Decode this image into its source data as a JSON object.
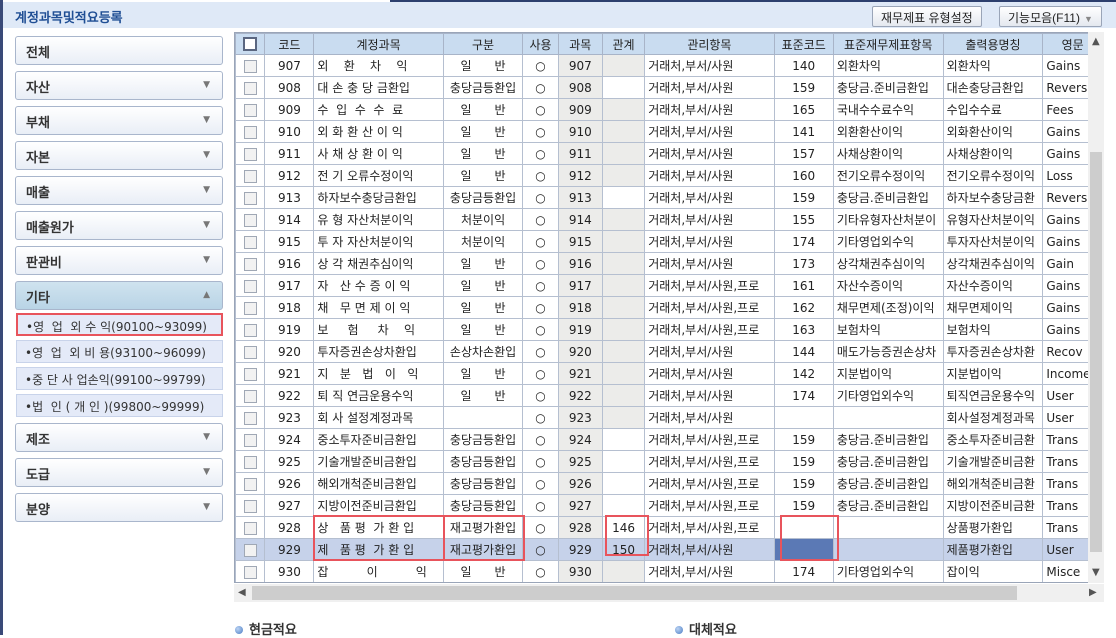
{
  "window": {
    "title": "계정과목및적요등록"
  },
  "toolbar": {
    "fs_type_label": "재무제표 유형설정",
    "functions_label": "기능모음(F11)"
  },
  "sidebar": {
    "groups": [
      {
        "label": "전체"
      },
      {
        "label": "자산"
      },
      {
        "label": "부채"
      },
      {
        "label": "자본"
      },
      {
        "label": "매출"
      },
      {
        "label": "매출원가"
      },
      {
        "label": "판관비"
      },
      {
        "label": "기타",
        "open": true
      },
      {
        "label": "제조"
      },
      {
        "label": "도급"
      },
      {
        "label": "분양"
      }
    ],
    "subitems": [
      {
        "label": "•영  업  외 수 익(90100~93099)",
        "selected": true
      },
      {
        "label": "•영  업  외 비 용(93100~96099)"
      },
      {
        "label": "•중 단 사 업손익(99100~99799)"
      },
      {
        "label": "•법  인 ( 개 인 )(99800~99999)"
      }
    ]
  },
  "table": {
    "columns": [
      "",
      "코드",
      "계정과목",
      "구분",
      "사용",
      "과목",
      "관계",
      "관리항목",
      "표준코드",
      "표준재무제표항목",
      "출력용명칭",
      "영문"
    ],
    "rows": [
      {
        "code": "907",
        "name": "외    환    차    익",
        "type": "일      반",
        "use": "○",
        "subj": "907",
        "rel": "",
        "mgmt": "거래처,부서/사원",
        "std": "140",
        "stdname": "외환차익",
        "out": "외환차익",
        "eng": "Gains",
        "relw": false
      },
      {
        "code": "908",
        "name": "대 손 충 당 금환입",
        "type": "충당금등환입",
        "use": "○",
        "subj": "908",
        "rel": "",
        "mgmt": "거래처,부서/사원",
        "std": "159",
        "stdname": "충당금.준비금환입",
        "out": "대손충당금환입",
        "eng": "Revers",
        "relw": true
      },
      {
        "code": "909",
        "name": "수  입  수  수  료",
        "type": "일      반",
        "use": "○",
        "subj": "909",
        "rel": "",
        "mgmt": "거래처,부서/사원",
        "std": "165",
        "stdname": "국내수수료수익",
        "out": "수입수수료",
        "eng": "Fees",
        "relw": false
      },
      {
        "code": "910",
        "name": "외 화 환 산 이 익",
        "type": "일      반",
        "use": "○",
        "subj": "910",
        "rel": "",
        "mgmt": "거래처,부서/사원",
        "std": "141",
        "stdname": "외환환산이익",
        "out": "외화환산이익",
        "eng": "Gains",
        "relw": false
      },
      {
        "code": "911",
        "name": "사 채 상 환 이 익",
        "type": "일      반",
        "use": "○",
        "subj": "911",
        "rel": "",
        "mgmt": "거래처,부서/사원",
        "std": "157",
        "stdname": "사채상환이익",
        "out": "사채상환이익",
        "eng": "Gains",
        "relw": false
      },
      {
        "code": "912",
        "name": "전 기 오류수정이익",
        "type": "일      반",
        "use": "○",
        "subj": "912",
        "rel": "",
        "mgmt": "거래처,부서/사원",
        "std": "160",
        "stdname": "전기오류수정이익",
        "out": "전기오류수정이익",
        "eng": "Loss",
        "relw": false
      },
      {
        "code": "913",
        "name": "하자보수충당금환입",
        "type": "충당금등환입",
        "use": "○",
        "subj": "913",
        "rel": "",
        "mgmt": "거래처,부서/사원",
        "std": "159",
        "stdname": "충당금.준비금환입",
        "out": "하자보수충당금환",
        "eng": "Revers",
        "relw": true
      },
      {
        "code": "914",
        "name": "유 형 자산처분이익",
        "type": "처분이익",
        "use": "○",
        "subj": "914",
        "rel": "",
        "mgmt": "거래처,부서/사원",
        "std": "155",
        "stdname": "기타유형자산처분이",
        "out": "유형자산처분이익",
        "eng": "Gains",
        "relw": false
      },
      {
        "code": "915",
        "name": "투 자 자산처분이익",
        "type": "처분이익",
        "use": "○",
        "subj": "915",
        "rel": "",
        "mgmt": "거래처,부서/사원",
        "std": "174",
        "stdname": "기타영업외수익",
        "out": "투자자산처분이익",
        "eng": "Gains",
        "relw": false
      },
      {
        "code": "916",
        "name": "상 각 채권추심이익",
        "type": "일      반",
        "use": "○",
        "subj": "916",
        "rel": "",
        "mgmt": "거래처,부서/사원",
        "std": "173",
        "stdname": "상각채권추심이익",
        "out": "상각채권추심이익",
        "eng": "Gain",
        "relw": false
      },
      {
        "code": "917",
        "name": "자   산 수 증 이 익",
        "type": "일      반",
        "use": "○",
        "subj": "917",
        "rel": "",
        "mgmt": "거래처,부서/사원,프로",
        "std": "161",
        "stdname": "자산수증이익",
        "out": "자산수증이익",
        "eng": "Gains",
        "relw": false
      },
      {
        "code": "918",
        "name": "채   무 면 제 이 익",
        "type": "일      반",
        "use": "○",
        "subj": "918",
        "rel": "",
        "mgmt": "거래처,부서/사원,프로",
        "std": "162",
        "stdname": "채무면제(조정)이익",
        "out": "채무면제이익",
        "eng": "Gains",
        "relw": false
      },
      {
        "code": "919",
        "name": "보     험     차    익",
        "type": "일      반",
        "use": "○",
        "subj": "919",
        "rel": "",
        "mgmt": "거래처,부서/사원,프로",
        "std": "163",
        "stdname": "보험차익",
        "out": "보험차익",
        "eng": "Gains",
        "relw": false
      },
      {
        "code": "920",
        "name": "투자증권손상차환입",
        "type": "손상차손환입",
        "use": "○",
        "subj": "920",
        "rel": "",
        "mgmt": "거래처,부서/사원",
        "std": "144",
        "stdname": "매도가능증권손상차",
        "out": "투자증권손상차환",
        "eng": "Recov",
        "relw": false
      },
      {
        "code": "921",
        "name": "지   분   법   이   익",
        "type": "일      반",
        "use": "○",
        "subj": "921",
        "rel": "",
        "mgmt": "거래처,부서/사원",
        "std": "142",
        "stdname": "지분법이익",
        "out": "지분법이익",
        "eng": "Income",
        "relw": false
      },
      {
        "code": "922",
        "name": "퇴 직 연금운용수익",
        "type": "일      반",
        "use": "○",
        "subj": "922",
        "rel": "",
        "mgmt": "거래처,부서/사원",
        "std": "174",
        "stdname": "기타영업외수익",
        "out": "퇴직연금운용수익",
        "eng": "User",
        "relw": false
      },
      {
        "code": "923",
        "name": "회 사 설정계정과목",
        "type": "",
        "use": "○",
        "subj": "923",
        "rel": "",
        "mgmt": "거래처,부서/사원",
        "std": "",
        "stdname": "",
        "out": "회사설정계정과목",
        "eng": "User",
        "relw": false
      },
      {
        "code": "924",
        "name": "중소투자준비금환입",
        "type": "충당금등환입",
        "use": "○",
        "subj": "924",
        "rel": "",
        "mgmt": "거래처,부서/사원,프로",
        "std": "159",
        "stdname": "충당금.준비금환입",
        "out": "중소투자준비금환",
        "eng": "Trans",
        "relw": true
      },
      {
        "code": "925",
        "name": "기술개발준비금환입",
        "type": "충당금등환입",
        "use": "○",
        "subj": "925",
        "rel": "",
        "mgmt": "거래처,부서/사원,프로",
        "std": "159",
        "stdname": "충당금.준비금환입",
        "out": "기술개발준비금환",
        "eng": "Trans",
        "relw": true
      },
      {
        "code": "926",
        "name": "해외개척준비금환입",
        "type": "충당금등환입",
        "use": "○",
        "subj": "926",
        "rel": "",
        "mgmt": "거래처,부서/사원,프로",
        "std": "159",
        "stdname": "충당금.준비금환입",
        "out": "해외개척준비금환",
        "eng": "Trans",
        "relw": true
      },
      {
        "code": "927",
        "name": "지방이전준비금환입",
        "type": "충당금등환입",
        "use": "○",
        "subj": "927",
        "rel": "",
        "mgmt": "거래처,부서/사원,프로",
        "std": "159",
        "stdname": "충당금.준비금환입",
        "out": "지방이전준비금환",
        "eng": "Trans",
        "relw": true
      },
      {
        "code": "928",
        "name": "상   품 평  가 환 입",
        "type": "재고평가환입",
        "use": "○",
        "subj": "928",
        "rel": "146",
        "mgmt": "거래처,부서/사원,프로",
        "std": "",
        "stdname": "",
        "out": "상품평가환입",
        "eng": "Trans",
        "relw": true
      },
      {
        "code": "929",
        "name": "제   품 평  가 환 입",
        "type": "재고평가환입",
        "use": "○",
        "subj": "929",
        "rel": "150",
        "mgmt": "거래처,부서/사원",
        "std": "",
        "stdname": "",
        "out": "제품평가환입",
        "eng": "User",
        "relw": true,
        "selected": true
      },
      {
        "code": "930",
        "name": "잡          이          익",
        "type": "일      반",
        "use": "○",
        "subj": "930",
        "rel": "",
        "mgmt": "거래처,부서/사원",
        "std": "174",
        "stdname": "기타영업외수익",
        "out": "잡이익",
        "eng": "Misce",
        "relw": false
      }
    ]
  },
  "sections": {
    "cash": "현금적요",
    "transfer": "대체적요"
  }
}
